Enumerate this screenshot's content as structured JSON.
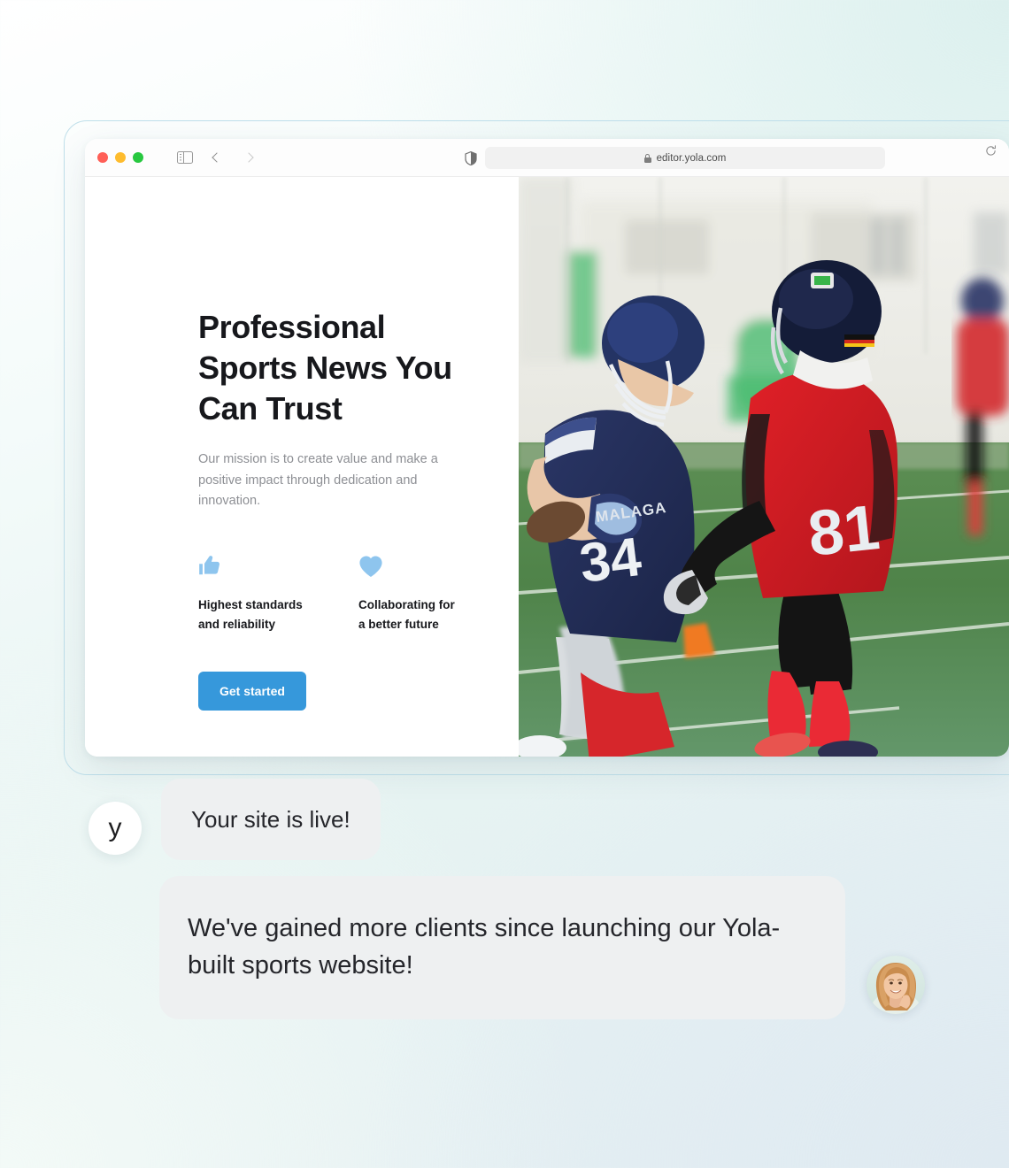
{
  "browser": {
    "traffic_lights": [
      {
        "name": "close",
        "color": "#ff5f57"
      },
      {
        "name": "minimize",
        "color": "#febc2e"
      },
      {
        "name": "maximize",
        "color": "#28c840"
      }
    ],
    "sidebar_toggle_icon": "sidebar-icon",
    "back_icon": "chevron-left-icon",
    "forward_icon": "chevron-right-icon",
    "shield_icon": "shield-icon",
    "lock_icon": "lock-icon",
    "url": "editor.yola.com",
    "reload_icon": "reload-icon"
  },
  "hero": {
    "headline": "Professional Sports News You Can Trust",
    "subtitle": "Our mission is to create value and make a positive impact through dedication and innovation.",
    "features": [
      {
        "icon": "thumbs-up-icon",
        "label": "Highest standards and reliability"
      },
      {
        "icon": "heart-icon",
        "label": "Collaborating for a better future"
      }
    ],
    "cta_label": "Get started",
    "accent_color": "#3698db",
    "feature_icon_color": "#8ec5ee"
  },
  "photo": {
    "alt": "American football players on a green turf field",
    "jersey_navy_number": "34",
    "jersey_navy_text": "MALAGA",
    "jersey_red_number": "81"
  },
  "chat": {
    "brand_avatar_letter": "y",
    "messages": [
      {
        "from": "brand",
        "text": "Your site is live!"
      },
      {
        "from": "user",
        "text": "We've gained more clients since launching our Yola-built sports website!"
      }
    ],
    "user_avatar": "woman-smiling-avatar"
  }
}
